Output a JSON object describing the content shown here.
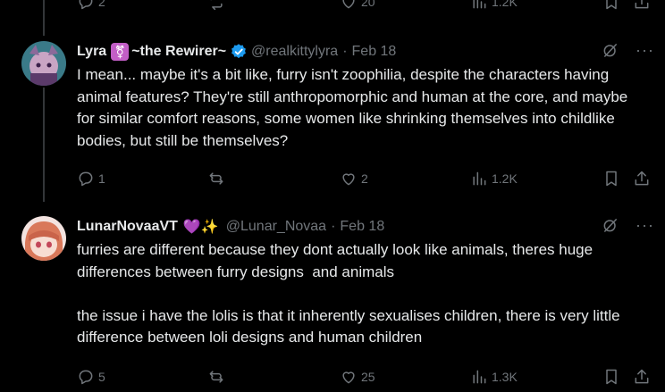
{
  "top_actions": {
    "replies": "2",
    "reposts": "",
    "likes": "20",
    "views": "1.2K"
  },
  "tweets": [
    {
      "display_name": "Lyra",
      "name_suffix": "~the Rewirer~",
      "emoji": "⚧",
      "handle": "@realkittylyra",
      "separator": "·",
      "date": "Feb 18",
      "text": "I mean... maybe it's a bit like, furry isn't zoophilia, despite the characters having animal features? They're still anthropomorphic and human at the core, and maybe for similar comfort reasons, some women like shrinking themselves into childlike bodies, but still be themselves?",
      "replies": "1",
      "reposts": "",
      "likes": "2",
      "views": "1.2K"
    },
    {
      "display_name": "LunarNovaaVT",
      "name_suffix": "",
      "emoji": "💜✨",
      "handle": "@Lunar_Novaa",
      "separator": "·",
      "date": "Feb 18",
      "text": "furries are different because they dont actually look like animals, theres huge differences between furry designs  and animals\n\nthe issue i have the lolis is that it inherently sexualises children, there is very little difference between loli designs and human children",
      "replies": "5",
      "reposts": "",
      "likes": "25",
      "views": "1.3K"
    }
  ],
  "more_label": "···",
  "colors": {
    "background": "#000000",
    "text": "#e7e9ea",
    "muted": "#71767b",
    "verified": "#1d9bf0",
    "thread_line": "#333639"
  }
}
